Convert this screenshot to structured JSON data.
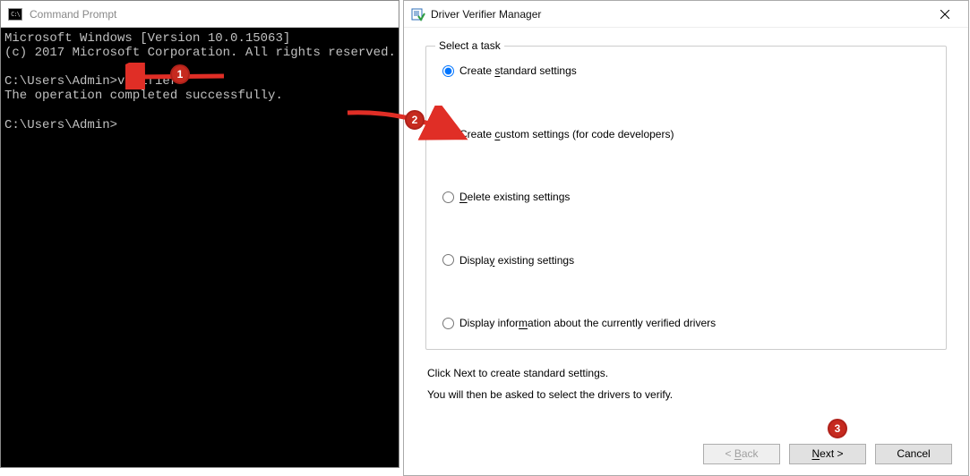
{
  "cmd": {
    "title": "Command Prompt",
    "lines": [
      "Microsoft Windows [Version 10.0.15063]",
      "(c) 2017 Microsoft Corporation. All rights reserved.",
      "",
      "C:\\Users\\Admin>verifier",
      "The operation completed successfully.",
      "",
      "C:\\Users\\Admin>"
    ]
  },
  "dvm": {
    "title": "Driver Verifier Manager",
    "group_label": "Select a task",
    "options": {
      "standard": "Create standard settings",
      "custom": "Create custom settings (for code developers)",
      "delete": "Delete existing settings",
      "display": "Display existing settings",
      "info": "Display information about the currently verified drivers"
    },
    "hint1": "Click Next to create standard settings.",
    "hint2": "You will then be asked to select the drivers to verify.",
    "buttons": {
      "back": "< Back",
      "next": "Next >",
      "cancel": "Cancel"
    }
  },
  "annotations": {
    "b1": "1",
    "b2": "2",
    "b3": "3"
  }
}
